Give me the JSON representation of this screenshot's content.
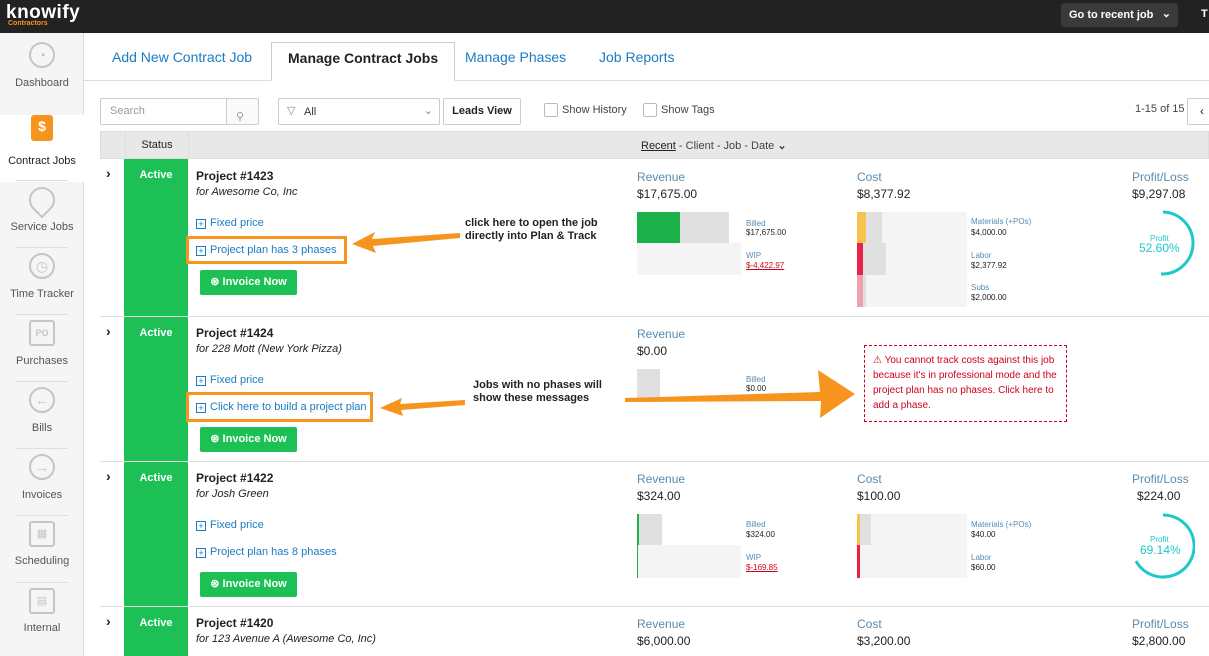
{
  "app": {
    "logo": "knowify",
    "logo_sub": "Contractors"
  },
  "topbar": {
    "recent_btn": "Go to recent job",
    "user_initial": "T"
  },
  "sidebar": {
    "items": [
      {
        "label": "Dashboard"
      },
      {
        "label": "Contract Jobs"
      },
      {
        "label": "Service Jobs"
      },
      {
        "label": "Time Tracker"
      },
      {
        "label": "Purchases"
      },
      {
        "label": "Bills"
      },
      {
        "label": "Invoices"
      },
      {
        "label": "Scheduling"
      },
      {
        "label": "Internal"
      }
    ]
  },
  "tabs": [
    "Add New Contract Job",
    "Manage Contract Jobs",
    "Manage Phases",
    "Job Reports"
  ],
  "toolbar": {
    "search_placeholder": "Search",
    "filter_value": "All",
    "leads_view": "Leads View",
    "show_history": "Show History",
    "show_tags": "Show Tags",
    "pager": "1-15 of 15"
  },
  "table": {
    "status_header": "Status",
    "sort_recent": "Recent",
    "sort_rest": " - Client - Job - Date"
  },
  "labels": {
    "revenue": "Revenue",
    "cost": "Cost",
    "profit_loss": "Profit/Loss",
    "billed": "Billed",
    "wip": "WIP",
    "materials": "Materials (+POs)",
    "labor": "Labor",
    "subs": "Subs",
    "profit": "Profit",
    "invoice_now": "Invoice Now",
    "fixed_price": "Fixed price",
    "active": "Active"
  },
  "rows": [
    {
      "project": "Project #1423",
      "client": "for Awesome Co, Inc",
      "plan_link": "Project plan has 3 phases",
      "revenue": "$17,675.00",
      "billed": "$17,675.00",
      "wip": "$-4,422.97",
      "cost": "$8,377.92",
      "materials": "$4,000.00",
      "labor": "$2,377.92",
      "subs": "$2,000.00",
      "profit_loss": "$9,297.08",
      "profit_pct": "52.60%"
    },
    {
      "project": "Project #1424",
      "client": "for 228 Mott (New York Pizza)",
      "plan_link": "Click here to build a project plan",
      "revenue": "$0.00",
      "billed": "$0.00"
    },
    {
      "project": "Project #1422",
      "client": "for Josh Green",
      "plan_link": "Project plan has 8 phases",
      "revenue": "$324.00",
      "billed": "$324.00",
      "wip": "$-169.85",
      "cost": "$100.00",
      "materials": "$40.00",
      "labor": "$60.00",
      "profit_loss": "$224.00",
      "profit_pct": "69.14%"
    },
    {
      "project": "Project #1420",
      "client": "for 123 Avenue A (Awesome Co, Inc)",
      "revenue": "$6,000.00",
      "cost": "$3,200.00",
      "profit_loss": "$2,800.00"
    }
  ],
  "annotations": {
    "note1": "click here to open the job directly into Plan & Track",
    "note2": "Jobs with no phases will show these messages",
    "warning": "You cannot track costs against this job because it's in professional mode and the project plan has no phases. Click here to add a phase."
  },
  "colors": {
    "accent": "#1a7cc1",
    "active_green": "#1dc055",
    "annotation": "#f7941d",
    "error": "#d0021b",
    "profit_ring": "#1ec8c8"
  }
}
